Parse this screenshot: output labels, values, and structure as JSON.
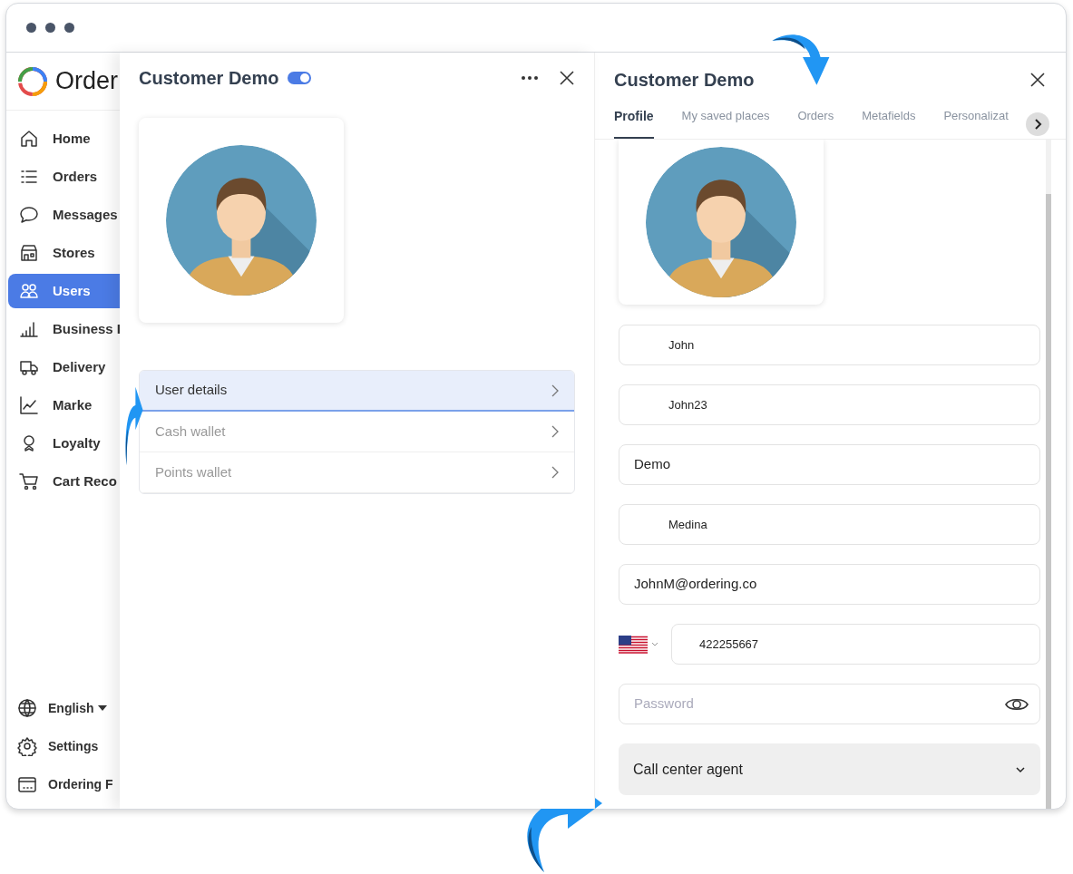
{
  "logo": {
    "text": "Order"
  },
  "sidebar": {
    "items": [
      {
        "label": "Home",
        "selected": false
      },
      {
        "label": "Orders",
        "selected": false
      },
      {
        "label": "Messages",
        "selected": false
      },
      {
        "label": "Stores",
        "selected": false
      },
      {
        "label": "Users",
        "selected": true
      },
      {
        "label": "Business I",
        "selected": false
      },
      {
        "label": "Delivery",
        "selected": false
      },
      {
        "label": "Marke",
        "selected": false
      },
      {
        "label": "Loyalty",
        "selected": false
      },
      {
        "label": "Cart Reco",
        "selected": false
      }
    ],
    "bottom": [
      {
        "label": "English",
        "dropdown": true
      },
      {
        "label": "Settings",
        "dropdown": false
      },
      {
        "label": "Ordering F",
        "dropdown": false
      }
    ]
  },
  "details_panel": {
    "title": "Customer Demo",
    "active": true,
    "menu": [
      {
        "label": "User details",
        "selected": true
      },
      {
        "label": "Cash wallet",
        "selected": false
      },
      {
        "label": "Points wallet",
        "selected": false
      }
    ]
  },
  "profile_panel": {
    "title": "Customer Demo",
    "tabs": [
      {
        "label": "Profile",
        "selected": true
      },
      {
        "label": "My saved places",
        "selected": false
      },
      {
        "label": "Orders",
        "selected": false
      },
      {
        "label": "Metafields",
        "selected": false
      },
      {
        "label": "Personalizat",
        "selected": false
      }
    ],
    "fields": [
      {
        "kind": "text",
        "value": "John",
        "indent": true
      },
      {
        "kind": "text",
        "value": "John23",
        "indent": true
      },
      {
        "kind": "text",
        "value": "Demo",
        "indent": false
      },
      {
        "kind": "text",
        "value": "Medina",
        "indent": true
      },
      {
        "kind": "text",
        "value": "JohnM@ordering.co",
        "indent": false
      },
      {
        "kind": "phone",
        "value": "422255667",
        "indent": true
      },
      {
        "kind": "password",
        "placeholder": "Password",
        "indent": false
      }
    ],
    "role": "Call center agent"
  }
}
